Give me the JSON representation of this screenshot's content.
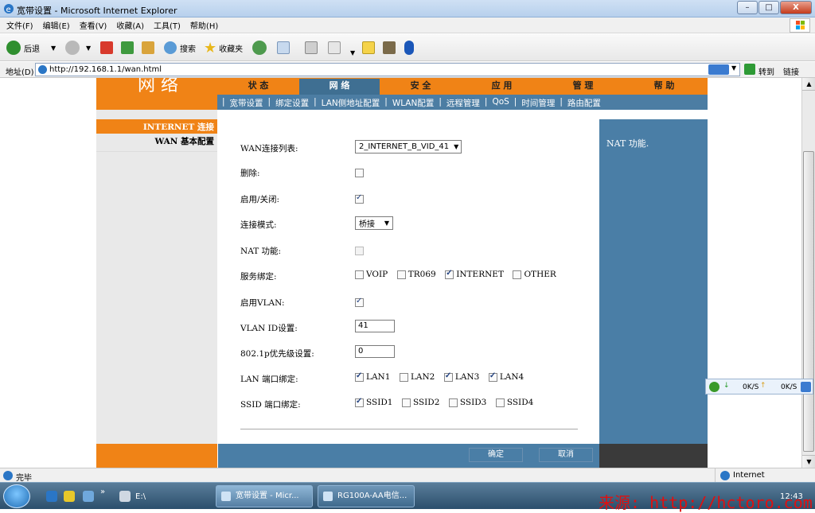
{
  "window": {
    "title": "宽带设置 - Microsoft Internet Explorer",
    "min": "–",
    "max": "□",
    "close": "X"
  },
  "menu": [
    "文件(F)",
    "编辑(E)",
    "查看(V)",
    "收藏(A)",
    "工具(T)",
    "帮助(H)"
  ],
  "toolbar": {
    "back": "后退",
    "search": "搜索",
    "favorites": "收藏夹"
  },
  "address": {
    "label": "地址(D)",
    "url": "http://192.168.1.1/wan.html",
    "go": "转到",
    "links": "链接"
  },
  "router": {
    "brand": "网 络",
    "nav": [
      "状 态",
      "网 络",
      "安 全",
      "应 用",
      "管 理",
      "帮 助"
    ],
    "subnav": [
      "宽带设置",
      "绑定设置",
      "LAN侧地址配置",
      "WLAN配置",
      "远程管理",
      "QoS",
      "时间管理",
      "路由配置"
    ],
    "sidebar": {
      "active": "INTERNET 连接",
      "item": "WAN 基本配置"
    },
    "help_text": "NAT 功能.",
    "form": {
      "wan_list_label": "WAN连接列表:",
      "wan_list_value": "2_INTERNET_B_VID_41",
      "delete_label": "删除:",
      "enable_label": "启用/关闭:",
      "mode_label": "连接模式:",
      "mode_value": "桥接",
      "nat_label": "NAT 功能:",
      "service_label": "服务绑定:",
      "services": [
        "VOIP",
        "TR069",
        "INTERNET",
        "OTHER"
      ],
      "vlan_enable_label": "启用VLAN:",
      "vlan_id_label": "VLAN ID设置:",
      "vlan_id_value": "41",
      "priority_label": "802.1p优先级设置:",
      "priority_value": "0",
      "lan_bind_label": "LAN 端口绑定:",
      "lan_ports": [
        "LAN1",
        "LAN2",
        "LAN3",
        "LAN4"
      ],
      "ssid_bind_label": "SSID 端口绑定:",
      "ssids": [
        "SSID1",
        "SSID2",
        "SSID3",
        "SSID4"
      ]
    },
    "buttons": {
      "ok": "确定",
      "cancel": "取消"
    }
  },
  "status": {
    "done": "完毕",
    "zone": "Internet"
  },
  "net_widget": {
    "down": "0K/S",
    "up": "0K/S"
  },
  "taskbar": {
    "drive": "E:\\",
    "task1": "宽带设置 - Micr...",
    "task2": "RG100A-AA电信...",
    "clock": "12:43"
  },
  "watermark": "来源: http://hctoro.com"
}
